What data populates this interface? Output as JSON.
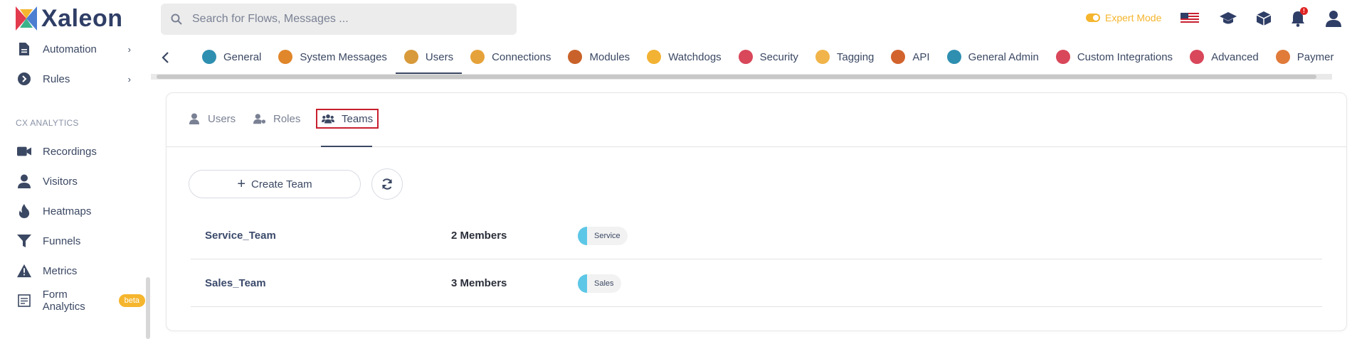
{
  "brand": {
    "name": "Xaleon"
  },
  "search": {
    "placeholder": "Search for Flows, Messages ..."
  },
  "header": {
    "expert_mode_label": "Expert Mode",
    "notification_count": "!"
  },
  "sidebar": {
    "items_top": [
      {
        "label": "Automation",
        "icon": "automation-icon"
      },
      {
        "label": "Rules",
        "icon": "rules-icon"
      }
    ],
    "section_label": "CX ANALYTICS",
    "items": [
      {
        "label": "Recordings",
        "icon": "video-icon"
      },
      {
        "label": "Visitors",
        "icon": "user-icon"
      },
      {
        "label": "Heatmaps",
        "icon": "flame-icon"
      },
      {
        "label": "Funnels",
        "icon": "funnel-icon"
      },
      {
        "label": "Metrics",
        "icon": "warning-icon"
      },
      {
        "label": "Form Analytics",
        "icon": "form-icon",
        "badge": "beta"
      }
    ]
  },
  "tabs": [
    {
      "label": "General",
      "color": "#2f8fb0"
    },
    {
      "label": "System Messages",
      "color": "#e0862b"
    },
    {
      "label": "Users",
      "color": "#d89a3a",
      "active": true
    },
    {
      "label": "Connections",
      "color": "#e6a23a"
    },
    {
      "label": "Modules",
      "color": "#c9622a"
    },
    {
      "label": "Watchdogs",
      "color": "#f2b233"
    },
    {
      "label": "Security",
      "color": "#d9475a"
    },
    {
      "label": "Tagging",
      "color": "#f1b44a"
    },
    {
      "label": "API",
      "color": "#d2632d"
    },
    {
      "label": "General Admin",
      "color": "#2f8fb0"
    },
    {
      "label": "Custom Integrations",
      "color": "#d9475a"
    },
    {
      "label": "Advanced",
      "color": "#d9475a"
    },
    {
      "label": "Paymer",
      "color": "#e07b3a"
    }
  ],
  "subtabs": [
    {
      "label": "Users"
    },
    {
      "label": "Roles"
    },
    {
      "label": "Teams",
      "active": true
    }
  ],
  "actions": {
    "create_label": "Create Team"
  },
  "teams": [
    {
      "name": "Service_Team",
      "members": "2 Members",
      "tag": "Service"
    },
    {
      "name": "Sales_Team",
      "members": "3 Members",
      "tag": "Sales"
    }
  ],
  "colors": {
    "accent": "#f5b52d",
    "primary_text": "#3b4863",
    "tag_dot": "#5cc7e6",
    "active_outline": "#c8202f"
  }
}
